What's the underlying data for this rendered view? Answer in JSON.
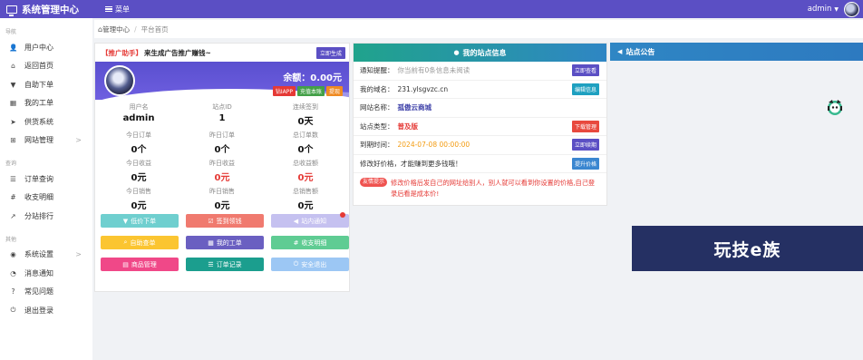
{
  "topbar": {
    "title": "系统管理中心",
    "menu_label": "菜单",
    "user": "admin"
  },
  "sidebar": {
    "groups": [
      {
        "label": "导航",
        "items": [
          {
            "label": "用户中心",
            "icon": "user-icon"
          },
          {
            "label": "返回首页",
            "icon": "home-icon"
          },
          {
            "label": "自助下单",
            "icon": "cart-icon"
          },
          {
            "label": "我的工单",
            "icon": "ticket-icon"
          },
          {
            "label": "供货系统",
            "icon": "send-icon"
          },
          {
            "label": "网站管理",
            "icon": "sitemap-icon",
            "arrow": ">"
          }
        ]
      },
      {
        "label": "查询",
        "items": [
          {
            "label": "订单查询",
            "icon": "list-icon"
          },
          {
            "label": "收支明细",
            "icon": "hash-icon"
          },
          {
            "label": "分站排行",
            "icon": "chart-icon"
          }
        ]
      },
      {
        "label": "其他",
        "items": [
          {
            "label": "系统设置",
            "icon": "gauge-icon",
            "arrow": ">"
          },
          {
            "label": "消息通知",
            "icon": "bell-icon"
          },
          {
            "label": "常见问题",
            "icon": "question-icon"
          },
          {
            "label": "退出登录",
            "icon": "power-icon"
          }
        ]
      }
    ]
  },
  "breadcrumb": {
    "home": "管理中心",
    "sep": "/",
    "current": "平台首页"
  },
  "left_card": {
    "promo_tag": "【推广助手】",
    "promo_text": "来生成广告推广赚钱~",
    "promo_btn": "立即生成",
    "balance": "余额：0.00元",
    "balance_btns": [
      "钻IAPP",
      "充值本账",
      "提现"
    ],
    "stats": [
      {
        "label": "用户名",
        "value": "admin"
      },
      {
        "label": "站点ID",
        "value": "1"
      },
      {
        "label": "连续签到",
        "value": "0天"
      },
      {
        "label": "今日订单",
        "value": "0个"
      },
      {
        "label": "昨日订单",
        "value": "0个"
      },
      {
        "label": "总订单数",
        "value": "0个"
      },
      {
        "label": "今日收益",
        "value": "0元"
      },
      {
        "label": "昨日收益",
        "value": "0元",
        "red": true
      },
      {
        "label": "总收益额",
        "value": "0元",
        "red": true
      },
      {
        "label": "今日销售",
        "value": "0元"
      },
      {
        "label": "昨日销售",
        "value": "0元"
      },
      {
        "label": "总销售额",
        "value": "0元"
      }
    ],
    "actions": [
      {
        "label": "低价下单",
        "icon": "cart-icon",
        "color": "#6fcfcf"
      },
      {
        "label": "签到领钱",
        "icon": "check-icon",
        "color": "#f07a6f"
      },
      {
        "label": "站内通知",
        "icon": "bullhorn-icon",
        "color": "#c5c1f0",
        "dot": true
      },
      {
        "label": "自助查单",
        "icon": "search-icon",
        "color": "#fbc531"
      },
      {
        "label": "我的工单",
        "icon": "ticket-icon",
        "color": "#6a5fc1"
      },
      {
        "label": "收支明细",
        "icon": "hash-icon",
        "color": "#5fcc93"
      },
      {
        "label": "商品管理",
        "icon": "box-icon",
        "color": "#f04888"
      },
      {
        "label": "订单记录",
        "icon": "list-icon",
        "color": "#1b9e8e"
      },
      {
        "label": "安全退出",
        "icon": "power-icon",
        "color": "#9cc7f4"
      }
    ]
  },
  "site_info": {
    "title": "我的站点信息",
    "rows": [
      {
        "key": "通知提醒：",
        "value": "你当前有0条信息未阅读",
        "style": "gray",
        "btn": "立即查看",
        "btn_color": "#5b4fc4"
      },
      {
        "key": "我的域名：",
        "value": "231.ylsgvzc.cn",
        "style": "",
        "btn": "编辑信息",
        "btn_color": "#1ea0c0"
      },
      {
        "key": "网站名称：",
        "value": "孤傲云商城",
        "style": "navy",
        "btn": "",
        "btn_color": ""
      },
      {
        "key": "站点类型：",
        "value": "普及版",
        "style": "red",
        "btn": "下载管理",
        "btn_color": "#e8493e"
      },
      {
        "key": "到期时间：",
        "value": "2024-07-08 00:00:00",
        "style": "orange",
        "btn": "立即续期",
        "btn_color": "#5b4fc4"
      },
      {
        "key": "修改好价格，才能赚到更多钱哦！",
        "value": "",
        "style": "",
        "btn": "提升价格",
        "btn_color": "#3a86d0"
      }
    ],
    "tip_tag": "友情提示",
    "tip_msg": "修改价格后发自己的网址给别人，别人就可以看到你设置的价格,自己登录后看是成本价!"
  },
  "announce": {
    "title": "站点公告"
  },
  "ad": {
    "text": "玩技e族"
  }
}
